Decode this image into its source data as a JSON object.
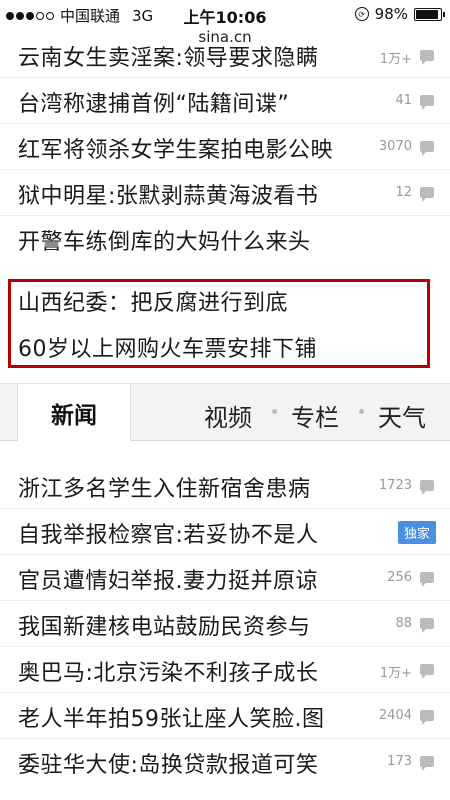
{
  "status_bar": {
    "carrier": "中国联通",
    "network": "3G",
    "time": "上午10:06",
    "battery": "98%"
  },
  "browser": {
    "url": "sina.cn"
  },
  "top_news": [
    {
      "title": "云南女生卖淫案:领导要求隐瞒",
      "count": "1万+"
    },
    {
      "title": "台湾称逮捕首例“陆籍间谍”",
      "count": "41"
    },
    {
      "title": "红军将领杀女学生案拍电影公映",
      "count": "3070"
    },
    {
      "title": "狱中明星:张默剥蒜黄海波看书",
      "count": "12"
    },
    {
      "title": "开警车练倒库的大妈什么来头",
      "count": ""
    }
  ],
  "highlight": {
    "line1": "山西纪委：把反腐进行到底",
    "line2": "60岁以上网购火车票安排下铺"
  },
  "tabs": {
    "active": "新闻",
    "items": [
      "视频",
      "专栏",
      "天气"
    ]
  },
  "news_list": [
    {
      "title": "浙江多名学生入住新宿舍患病",
      "count": "1723"
    },
    {
      "title": "自我举报检察官:若妥协不是人",
      "badge": "独家"
    },
    {
      "title": "官员遭情妇举报.妻力挺并原谅",
      "count": "256"
    },
    {
      "title": "我国新建核电站鼓励民资参与",
      "count": "88"
    },
    {
      "title": "奥巴马:北京污染不利孩子成长",
      "count": "1万+"
    },
    {
      "title": "老人半年拍59张让座人笑脸.图",
      "count": "2404"
    },
    {
      "title": "委驻华大使:岛换贷款报道可笑",
      "count": "173"
    }
  ]
}
